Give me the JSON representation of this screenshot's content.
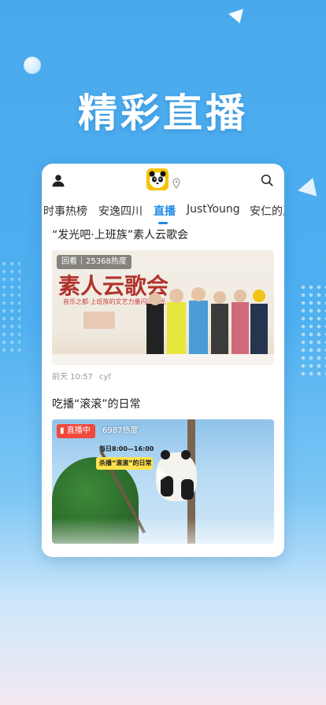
{
  "hero": {
    "title": "精彩直播"
  },
  "header": {
    "user_icon": "user-icon",
    "logo_icon": "panda-logo",
    "location_icon": "location-icon",
    "search_icon": "search-icon"
  },
  "tabs": [
    {
      "label": "时事热榜"
    },
    {
      "label": "安逸四川"
    },
    {
      "label": "直播",
      "active": true
    },
    {
      "label": "JustYoung"
    },
    {
      "label": "安仁的夏"
    }
  ],
  "posts": [
    {
      "title": "“发光吧·上班族”素人云歌会",
      "badge": "回看",
      "heat": "25368热度",
      "poster_title": "素人云歌会",
      "poster_sub": "音乐之都·上班族的文艺力量闪闪发光",
      "time": "前天 10:57",
      "author": "cyf"
    },
    {
      "title": "吃播“滚滚”的日常",
      "badge": "直播中",
      "heat": "6987热度",
      "sign_line1": "每日8:00—16:00",
      "sign_line2": "杀播“滚滚”的日常"
    }
  ],
  "colors": {
    "accent": "#1f8ae6",
    "background": "#49a9ec",
    "live_red": "#f14a3c"
  }
}
